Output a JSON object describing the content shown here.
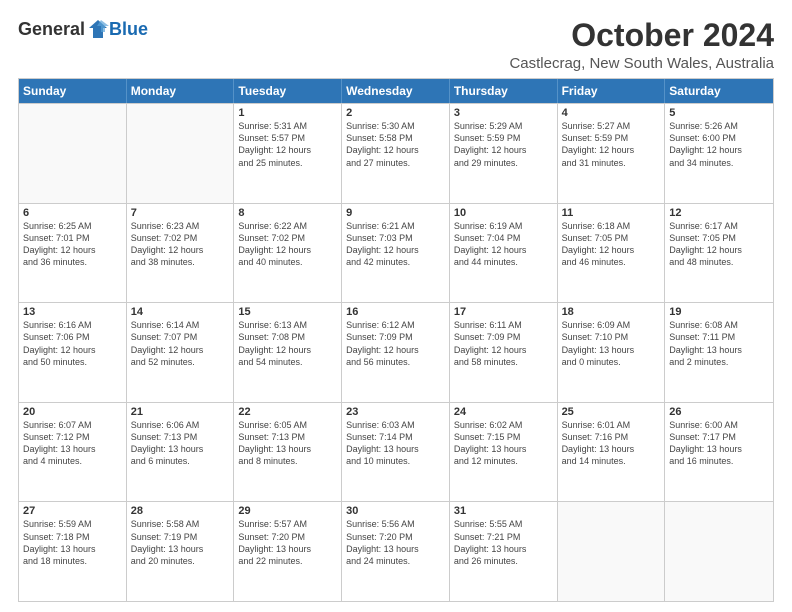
{
  "logo": {
    "general": "General",
    "blue": "Blue"
  },
  "title": "October 2024",
  "subtitle": "Castlecrag, New South Wales, Australia",
  "header_days": [
    "Sunday",
    "Monday",
    "Tuesday",
    "Wednesday",
    "Thursday",
    "Friday",
    "Saturday"
  ],
  "weeks": [
    [
      {
        "day": "",
        "empty": true
      },
      {
        "day": "",
        "empty": true
      },
      {
        "day": "1",
        "lines": [
          "Sunrise: 5:31 AM",
          "Sunset: 5:57 PM",
          "Daylight: 12 hours",
          "and 25 minutes."
        ]
      },
      {
        "day": "2",
        "lines": [
          "Sunrise: 5:30 AM",
          "Sunset: 5:58 PM",
          "Daylight: 12 hours",
          "and 27 minutes."
        ]
      },
      {
        "day": "3",
        "lines": [
          "Sunrise: 5:29 AM",
          "Sunset: 5:59 PM",
          "Daylight: 12 hours",
          "and 29 minutes."
        ]
      },
      {
        "day": "4",
        "lines": [
          "Sunrise: 5:27 AM",
          "Sunset: 5:59 PM",
          "Daylight: 12 hours",
          "and 31 minutes."
        ]
      },
      {
        "day": "5",
        "lines": [
          "Sunrise: 5:26 AM",
          "Sunset: 6:00 PM",
          "Daylight: 12 hours",
          "and 34 minutes."
        ]
      }
    ],
    [
      {
        "day": "6",
        "lines": [
          "Sunrise: 6:25 AM",
          "Sunset: 7:01 PM",
          "Daylight: 12 hours",
          "and 36 minutes."
        ]
      },
      {
        "day": "7",
        "lines": [
          "Sunrise: 6:23 AM",
          "Sunset: 7:02 PM",
          "Daylight: 12 hours",
          "and 38 minutes."
        ]
      },
      {
        "day": "8",
        "lines": [
          "Sunrise: 6:22 AM",
          "Sunset: 7:02 PM",
          "Daylight: 12 hours",
          "and 40 minutes."
        ]
      },
      {
        "day": "9",
        "lines": [
          "Sunrise: 6:21 AM",
          "Sunset: 7:03 PM",
          "Daylight: 12 hours",
          "and 42 minutes."
        ]
      },
      {
        "day": "10",
        "lines": [
          "Sunrise: 6:19 AM",
          "Sunset: 7:04 PM",
          "Daylight: 12 hours",
          "and 44 minutes."
        ]
      },
      {
        "day": "11",
        "lines": [
          "Sunrise: 6:18 AM",
          "Sunset: 7:05 PM",
          "Daylight: 12 hours",
          "and 46 minutes."
        ]
      },
      {
        "day": "12",
        "lines": [
          "Sunrise: 6:17 AM",
          "Sunset: 7:05 PM",
          "Daylight: 12 hours",
          "and 48 minutes."
        ]
      }
    ],
    [
      {
        "day": "13",
        "lines": [
          "Sunrise: 6:16 AM",
          "Sunset: 7:06 PM",
          "Daylight: 12 hours",
          "and 50 minutes."
        ]
      },
      {
        "day": "14",
        "lines": [
          "Sunrise: 6:14 AM",
          "Sunset: 7:07 PM",
          "Daylight: 12 hours",
          "and 52 minutes."
        ]
      },
      {
        "day": "15",
        "lines": [
          "Sunrise: 6:13 AM",
          "Sunset: 7:08 PM",
          "Daylight: 12 hours",
          "and 54 minutes."
        ]
      },
      {
        "day": "16",
        "lines": [
          "Sunrise: 6:12 AM",
          "Sunset: 7:09 PM",
          "Daylight: 12 hours",
          "and 56 minutes."
        ]
      },
      {
        "day": "17",
        "lines": [
          "Sunrise: 6:11 AM",
          "Sunset: 7:09 PM",
          "Daylight: 12 hours",
          "and 58 minutes."
        ]
      },
      {
        "day": "18",
        "lines": [
          "Sunrise: 6:09 AM",
          "Sunset: 7:10 PM",
          "Daylight: 13 hours",
          "and 0 minutes."
        ]
      },
      {
        "day": "19",
        "lines": [
          "Sunrise: 6:08 AM",
          "Sunset: 7:11 PM",
          "Daylight: 13 hours",
          "and 2 minutes."
        ]
      }
    ],
    [
      {
        "day": "20",
        "lines": [
          "Sunrise: 6:07 AM",
          "Sunset: 7:12 PM",
          "Daylight: 13 hours",
          "and 4 minutes."
        ]
      },
      {
        "day": "21",
        "lines": [
          "Sunrise: 6:06 AM",
          "Sunset: 7:13 PM",
          "Daylight: 13 hours",
          "and 6 minutes."
        ]
      },
      {
        "day": "22",
        "lines": [
          "Sunrise: 6:05 AM",
          "Sunset: 7:13 PM",
          "Daylight: 13 hours",
          "and 8 minutes."
        ]
      },
      {
        "day": "23",
        "lines": [
          "Sunrise: 6:03 AM",
          "Sunset: 7:14 PM",
          "Daylight: 13 hours",
          "and 10 minutes."
        ]
      },
      {
        "day": "24",
        "lines": [
          "Sunrise: 6:02 AM",
          "Sunset: 7:15 PM",
          "Daylight: 13 hours",
          "and 12 minutes."
        ]
      },
      {
        "day": "25",
        "lines": [
          "Sunrise: 6:01 AM",
          "Sunset: 7:16 PM",
          "Daylight: 13 hours",
          "and 14 minutes."
        ]
      },
      {
        "day": "26",
        "lines": [
          "Sunrise: 6:00 AM",
          "Sunset: 7:17 PM",
          "Daylight: 13 hours",
          "and 16 minutes."
        ]
      }
    ],
    [
      {
        "day": "27",
        "lines": [
          "Sunrise: 5:59 AM",
          "Sunset: 7:18 PM",
          "Daylight: 13 hours",
          "and 18 minutes."
        ]
      },
      {
        "day": "28",
        "lines": [
          "Sunrise: 5:58 AM",
          "Sunset: 7:19 PM",
          "Daylight: 13 hours",
          "and 20 minutes."
        ]
      },
      {
        "day": "29",
        "lines": [
          "Sunrise: 5:57 AM",
          "Sunset: 7:20 PM",
          "Daylight: 13 hours",
          "and 22 minutes."
        ]
      },
      {
        "day": "30",
        "lines": [
          "Sunrise: 5:56 AM",
          "Sunset: 7:20 PM",
          "Daylight: 13 hours",
          "and 24 minutes."
        ]
      },
      {
        "day": "31",
        "lines": [
          "Sunrise: 5:55 AM",
          "Sunset: 7:21 PM",
          "Daylight: 13 hours",
          "and 26 minutes."
        ]
      },
      {
        "day": "",
        "empty": true
      },
      {
        "day": "",
        "empty": true
      }
    ]
  ]
}
